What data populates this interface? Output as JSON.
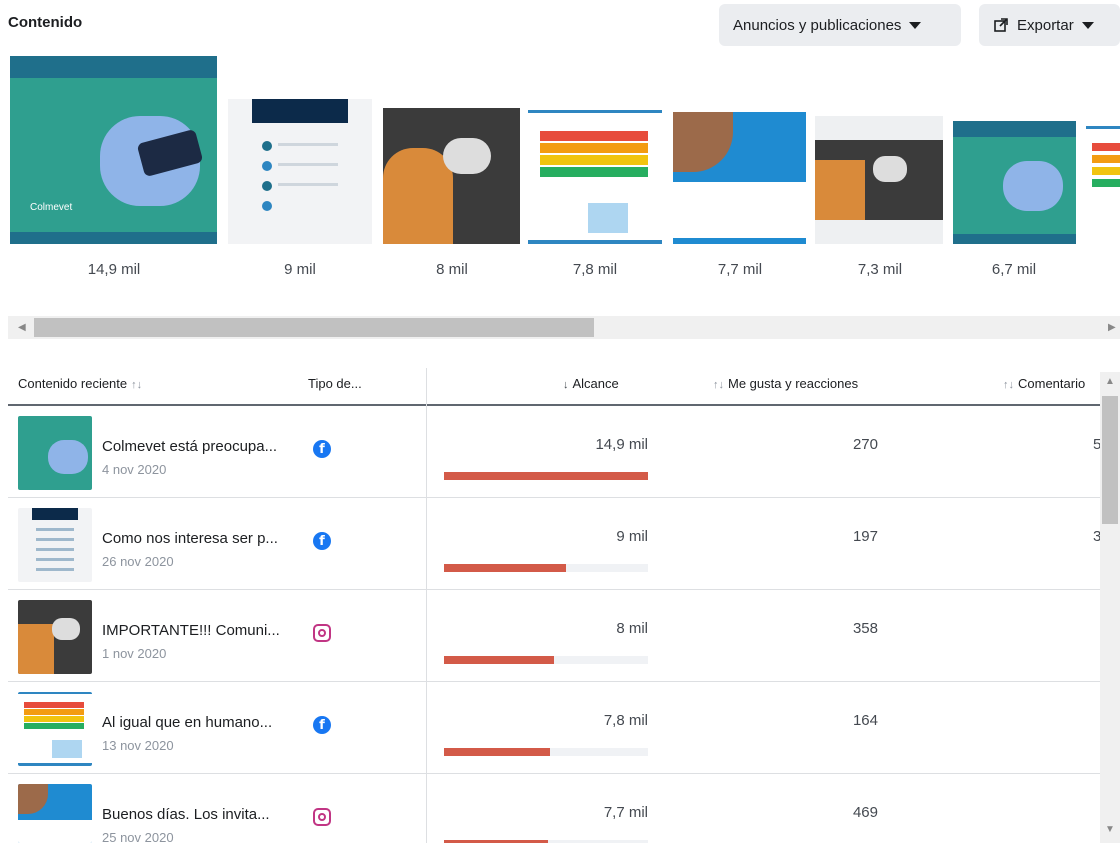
{
  "header": {
    "title": "Contenido",
    "filter_label": "Anuncios y publicaciones",
    "export_label": "Exportar"
  },
  "carousel": {
    "metrics": [
      "14,9 mil",
      "9 mil",
      "8 mil",
      "7,8 mil",
      "7,7 mil",
      "7,3 mil",
      "6,7 mil"
    ],
    "brand_text": "Colmevet"
  },
  "table": {
    "columns": {
      "content": "Contenido reciente",
      "type": "Tipo de...",
      "reach": "Alcance",
      "likes": "Me gusta y reacciones",
      "comments": "Comentario"
    },
    "rows": [
      {
        "title": "Colmevet está preocupa...",
        "date": "4 nov 2020",
        "platform": "facebook-icon",
        "reach": "14,9 mil",
        "reach_fraction": 1.0,
        "likes": "270",
        "comments": "5"
      },
      {
        "title": "Como nos interesa ser p...",
        "date": "26 nov 2020",
        "platform": "facebook-icon",
        "reach": "9 mil",
        "reach_fraction": 0.6,
        "likes": "197",
        "comments": "3"
      },
      {
        "title": "IMPORTANTE!!! Comuni...",
        "date": "1 nov 2020",
        "platform": "instagram-icon",
        "reach": "8 mil",
        "reach_fraction": 0.54,
        "likes": "358",
        "comments": ""
      },
      {
        "title": "Al igual que en humano...",
        "date": "13 nov 2020",
        "platform": "facebook-icon",
        "reach": "7,8 mil",
        "reach_fraction": 0.52,
        "likes": "164",
        "comments": ""
      },
      {
        "title": "Buenos días. Los invita...",
        "date": "25 nov 2020",
        "platform": "instagram-icon",
        "reach": "7,7 mil",
        "reach_fraction": 0.51,
        "likes": "469",
        "comments": ""
      }
    ]
  },
  "colors": {
    "bar_fill": "#d35a48",
    "facebook": "#1877f2",
    "instagram": "#c13584"
  }
}
